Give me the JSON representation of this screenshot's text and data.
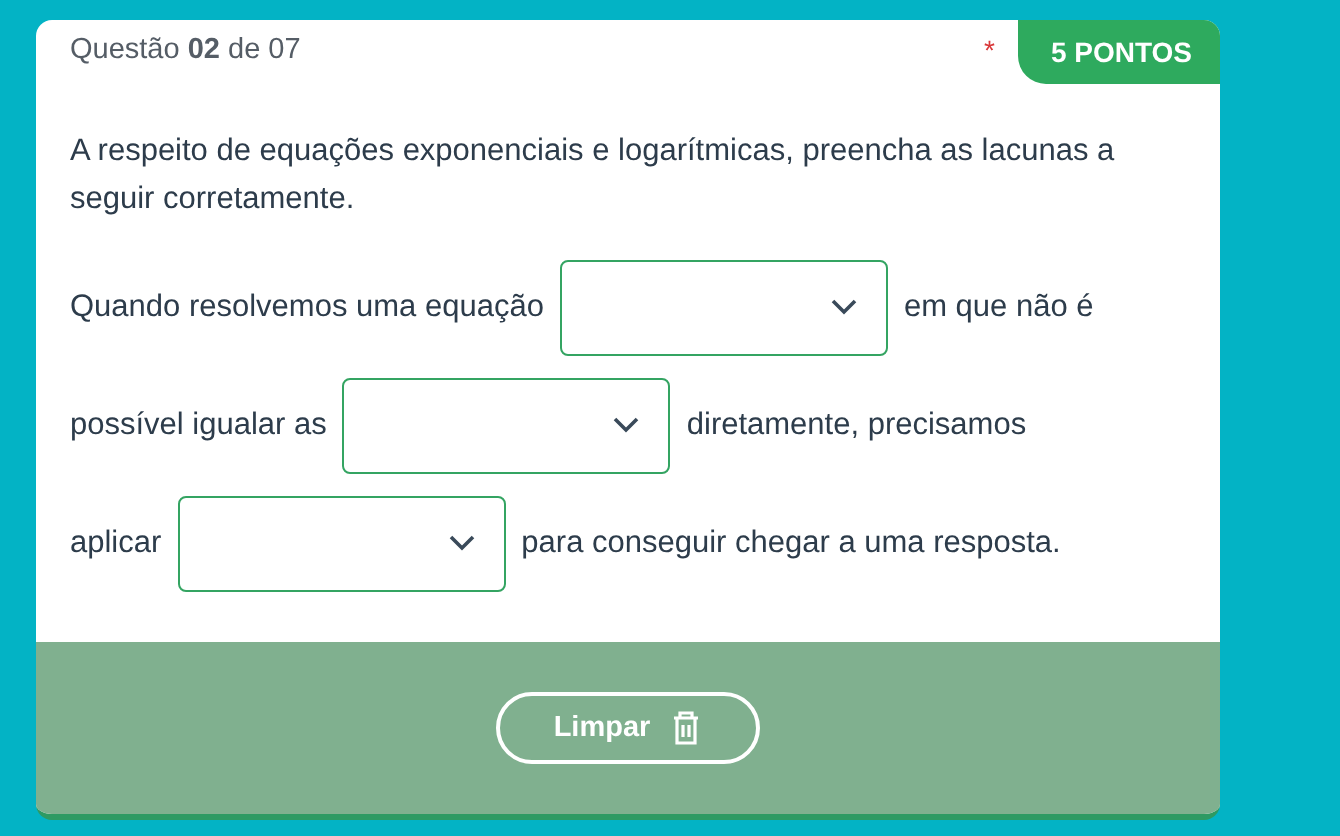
{
  "header": {
    "question": "Questão **02** de 07",
    "required_mark": "*",
    "points": "5 PONTOS"
  },
  "prompt": "A respeito de equações exponenciais e logarítmicas, preencha as lacunas a seguir corretamente.",
  "lines": [
    [
      {
        "kind": "text",
        "text": "Quando resolvemos uma equação"
      },
      {
        "kind": "select"
      },
      {
        "kind": "text",
        "text": "em que não é"
      }
    ],
    [
      {
        "kind": "text",
        "text": "possível igualar as"
      },
      {
        "kind": "select"
      },
      {
        "kind": "text",
        "text": "diretamente, precisamos"
      }
    ],
    [
      {
        "kind": "text",
        "text": "aplicar"
      },
      {
        "kind": "select"
      },
      {
        "kind": "text",
        "text": "para conseguir chegar a uma resposta."
      }
    ]
  ],
  "clear_button": {
    "label": "Limpar"
  }
}
